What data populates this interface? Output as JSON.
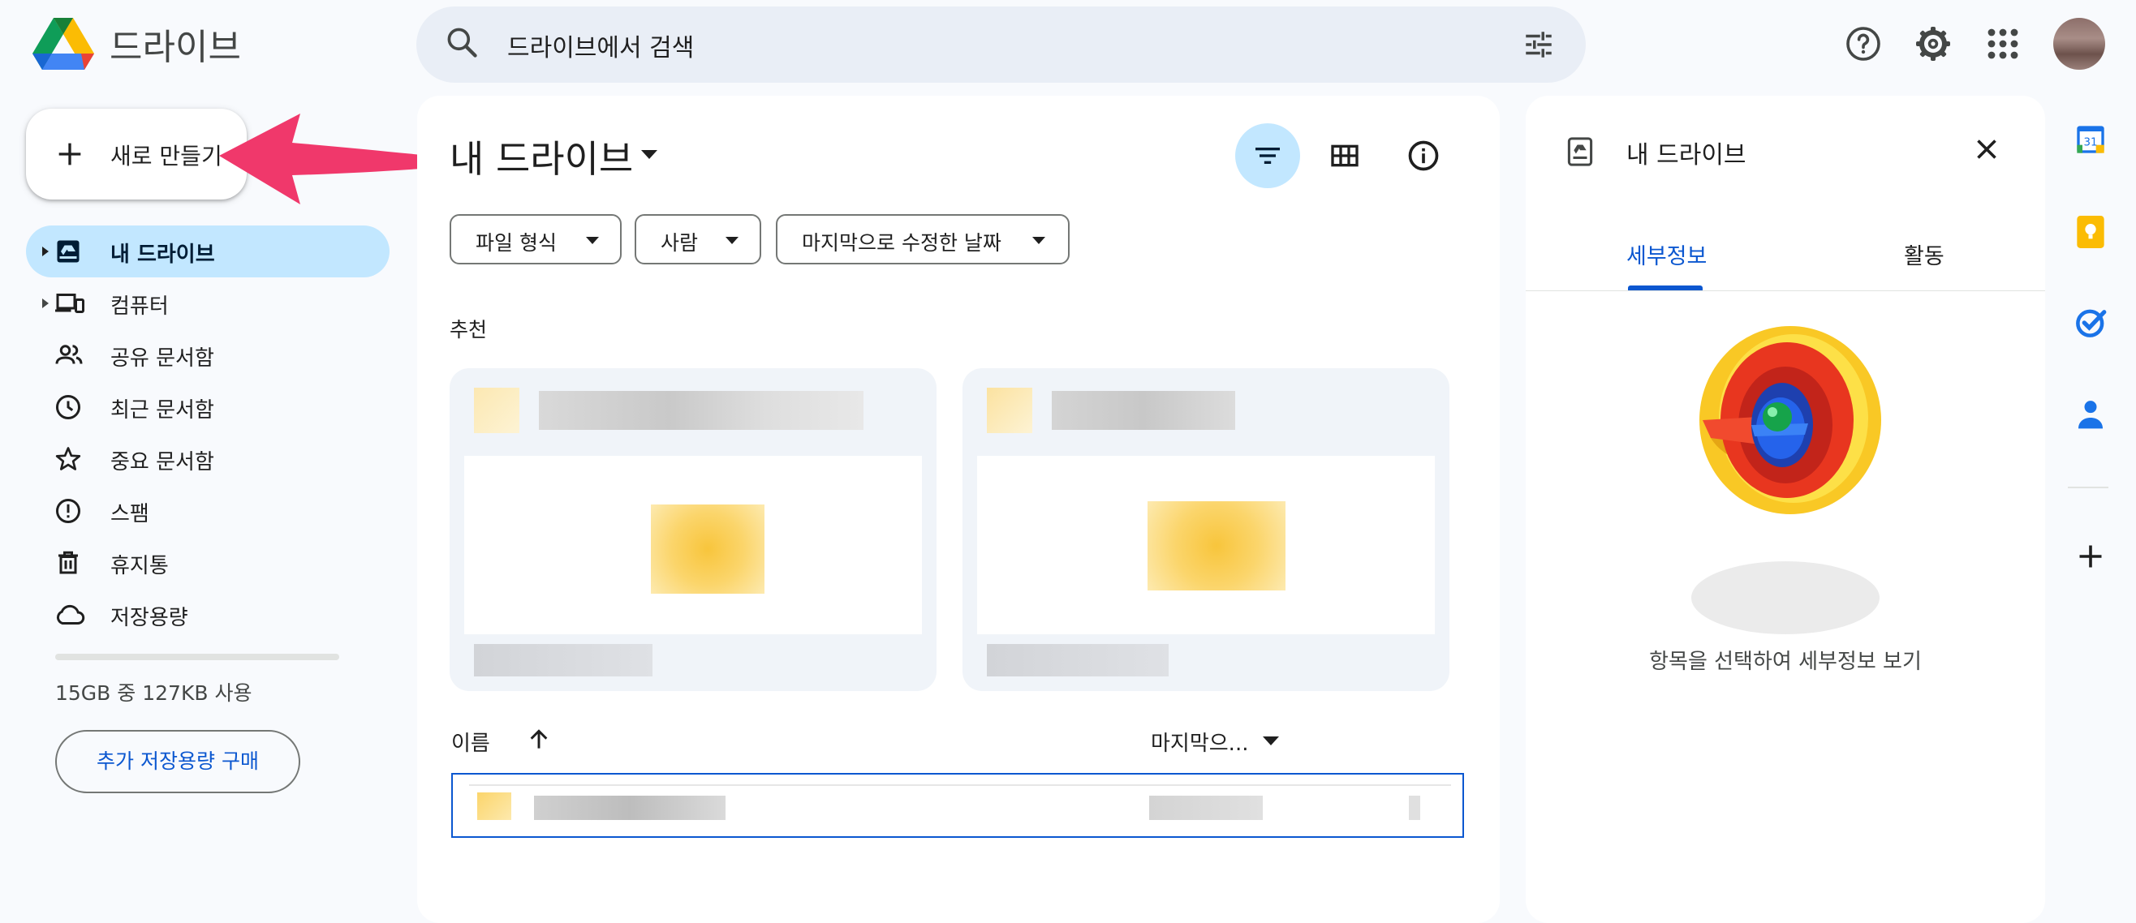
{
  "header": {
    "app_name": "드라이브",
    "search_placeholder": "드라이브에서 검색",
    "icons": [
      "drive-logo",
      "search-icon",
      "search-options-icon",
      "help-icon",
      "settings-icon",
      "apps-grid-icon",
      "avatar"
    ]
  },
  "sidebar": {
    "new_button_label": "새로 만들기",
    "items": [
      {
        "label": "내 드라이브",
        "icon": "my-drive-icon",
        "active": true,
        "expandable": true
      },
      {
        "label": "컴퓨터",
        "icon": "computers-icon",
        "active": false,
        "expandable": true
      },
      {
        "label": "공유 문서함",
        "icon": "shared-icon",
        "active": false,
        "expandable": false
      },
      {
        "label": "최근 문서함",
        "icon": "recent-icon",
        "active": false,
        "expandable": false
      },
      {
        "label": "중요 문서함",
        "icon": "star-icon",
        "active": false,
        "expandable": false
      },
      {
        "label": "스팸",
        "icon": "spam-icon",
        "active": false,
        "expandable": false
      },
      {
        "label": "휴지통",
        "icon": "trash-icon",
        "active": false,
        "expandable": false
      },
      {
        "label": "저장용량",
        "icon": "cloud-icon",
        "active": false,
        "expandable": false
      }
    ],
    "storage_text": "15GB 중 127KB 사용",
    "storage_used_fraction": 1e-05,
    "buy_storage_label": "추가 저장용량 구매"
  },
  "main": {
    "title": "내 드라이브",
    "filters": [
      "파일 형식",
      "사람",
      "마지막으로 수정한 날짜"
    ],
    "suggested_label": "추천",
    "columns": {
      "name": "이름",
      "modified": "마지막으..."
    }
  },
  "details": {
    "title": "내 드라이브",
    "tabs": [
      "세부정보",
      "활동"
    ],
    "active_tab": "세부정보",
    "empty_text": "항목을 선택하여 세부정보 보기"
  },
  "rail": {
    "icons": [
      "calendar-icon",
      "keep-icon",
      "tasks-icon",
      "contacts-icon",
      "add-icon"
    ],
    "calendar_day": "31"
  },
  "colors": {
    "accent": "#0b57d0",
    "active_nav": "#c2e7ff",
    "background": "#f8fafd",
    "annotation_arrow": "#f0386b"
  }
}
